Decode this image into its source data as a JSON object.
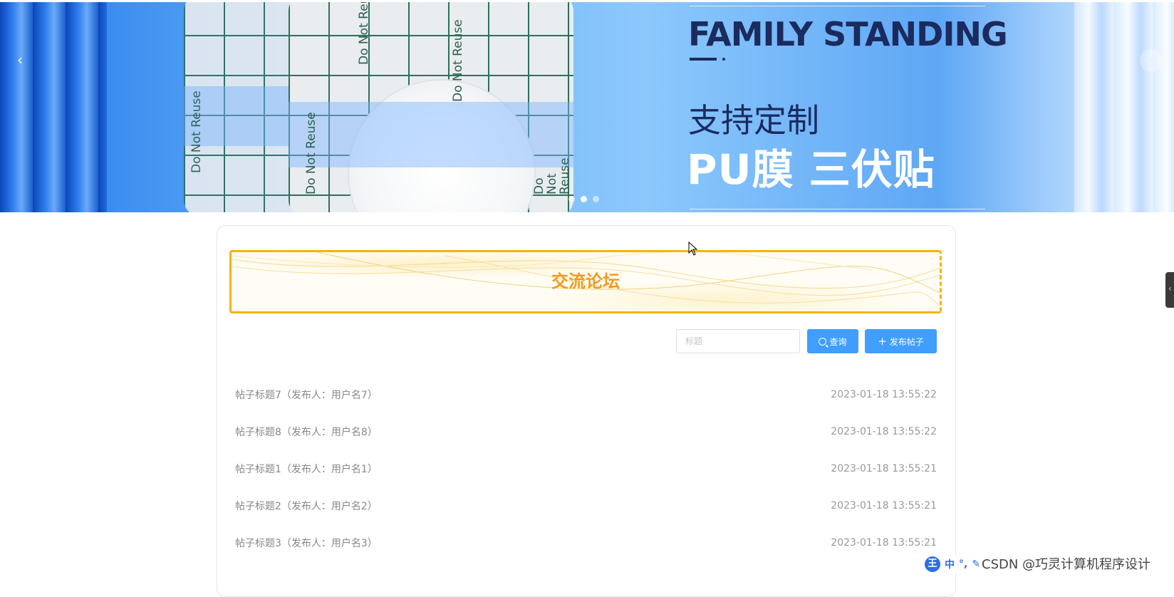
{
  "banner": {
    "headline": "FAMILY STANDING",
    "subline": "支持定制",
    "bigline": "PU膜 三伏贴",
    "stamp_text": "Do Not Reuse",
    "prev_arrow": "‹",
    "next_arrow": "›",
    "slide_count": 3,
    "active_slide": 2,
    "colors": {
      "headline": "#1b2b5e",
      "bigline": "#ffffff"
    }
  },
  "forum": {
    "title": "交流论坛",
    "search": {
      "placeholder": "标题",
      "value": ""
    },
    "search_button": "查询",
    "publish_button": "发布帖子",
    "posts": [
      {
        "title": "帖子标题7（发布人：用户名7）",
        "date": "2023-01-18 13:55:22"
      },
      {
        "title": "帖子标题8（发布人：用户名8）",
        "date": "2023-01-18 13:55:22"
      },
      {
        "title": "帖子标题1（发布人：用户名1）",
        "date": "2023-01-18 13:55:21"
      },
      {
        "title": "帖子标题2（发布人：用户名2）",
        "date": "2023-01-18 13:55:21"
      },
      {
        "title": "帖子标题3（发布人：用户名3）",
        "date": "2023-01-18 13:55:21"
      }
    ],
    "colors": {
      "accent": "#409eff",
      "title": "#f39a1a",
      "border": "#f5b400"
    }
  },
  "ime": {
    "logo": "王",
    "lang": "中",
    "punct": "°,"
  },
  "watermark": "CSDN @巧灵计算机程序设计"
}
